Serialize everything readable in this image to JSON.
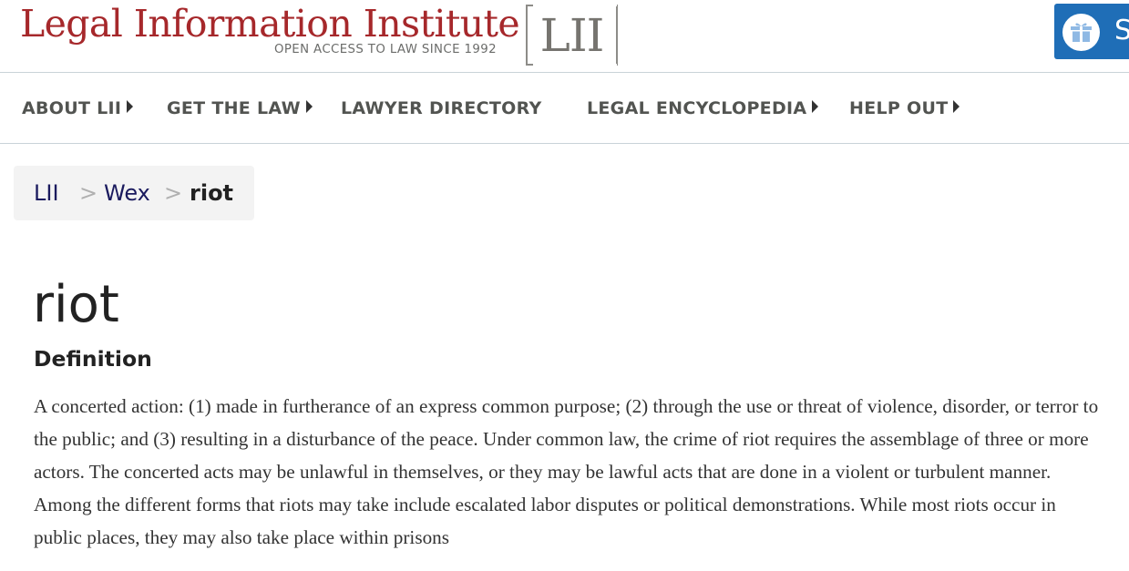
{
  "header": {
    "logo_title": "Legal Information Institute",
    "logo_tagline": "OPEN ACCESS TO LAW SINCE 1992",
    "logo_mark": "LII",
    "support_button_letter": "S",
    "support_icon": "gift-icon"
  },
  "nav": {
    "items": [
      {
        "label": "ABOUT LII",
        "has_submenu": true
      },
      {
        "label": "GET THE LAW",
        "has_submenu": true
      },
      {
        "label": "LAWYER DIRECTORY",
        "has_submenu": false
      },
      {
        "label": "LEGAL ENCYCLOPEDIA",
        "has_submenu": true
      },
      {
        "label": "HELP OUT",
        "has_submenu": true
      }
    ]
  },
  "breadcrumb": {
    "items": [
      "LII",
      "Wex"
    ],
    "separator": ">",
    "current": "riot"
  },
  "main": {
    "title": "riot",
    "section_heading": "Definition",
    "definition": "A concerted action: (1) made in furtherance of an express common purpose; (2) through the use or threat of violence, disorder, or terror to the public; and (3) resulting in a disturbance of the peace. Under common law, the crime of riot requires the assemblage of three or more actors. The concerted acts may be unlawful in themselves, or they may be lawful acts that are done in a violent or turbulent manner. Among the different forms that riots may take include escalated labor disputes or political demonstrations. While most riots occur in public places, they may also take place within prisons"
  },
  "colors": {
    "brand_red": "#a6282b",
    "support_blue": "#1f6eb7",
    "nav_text": "#525451",
    "breadcrumb_link": "#1a1a5e"
  }
}
